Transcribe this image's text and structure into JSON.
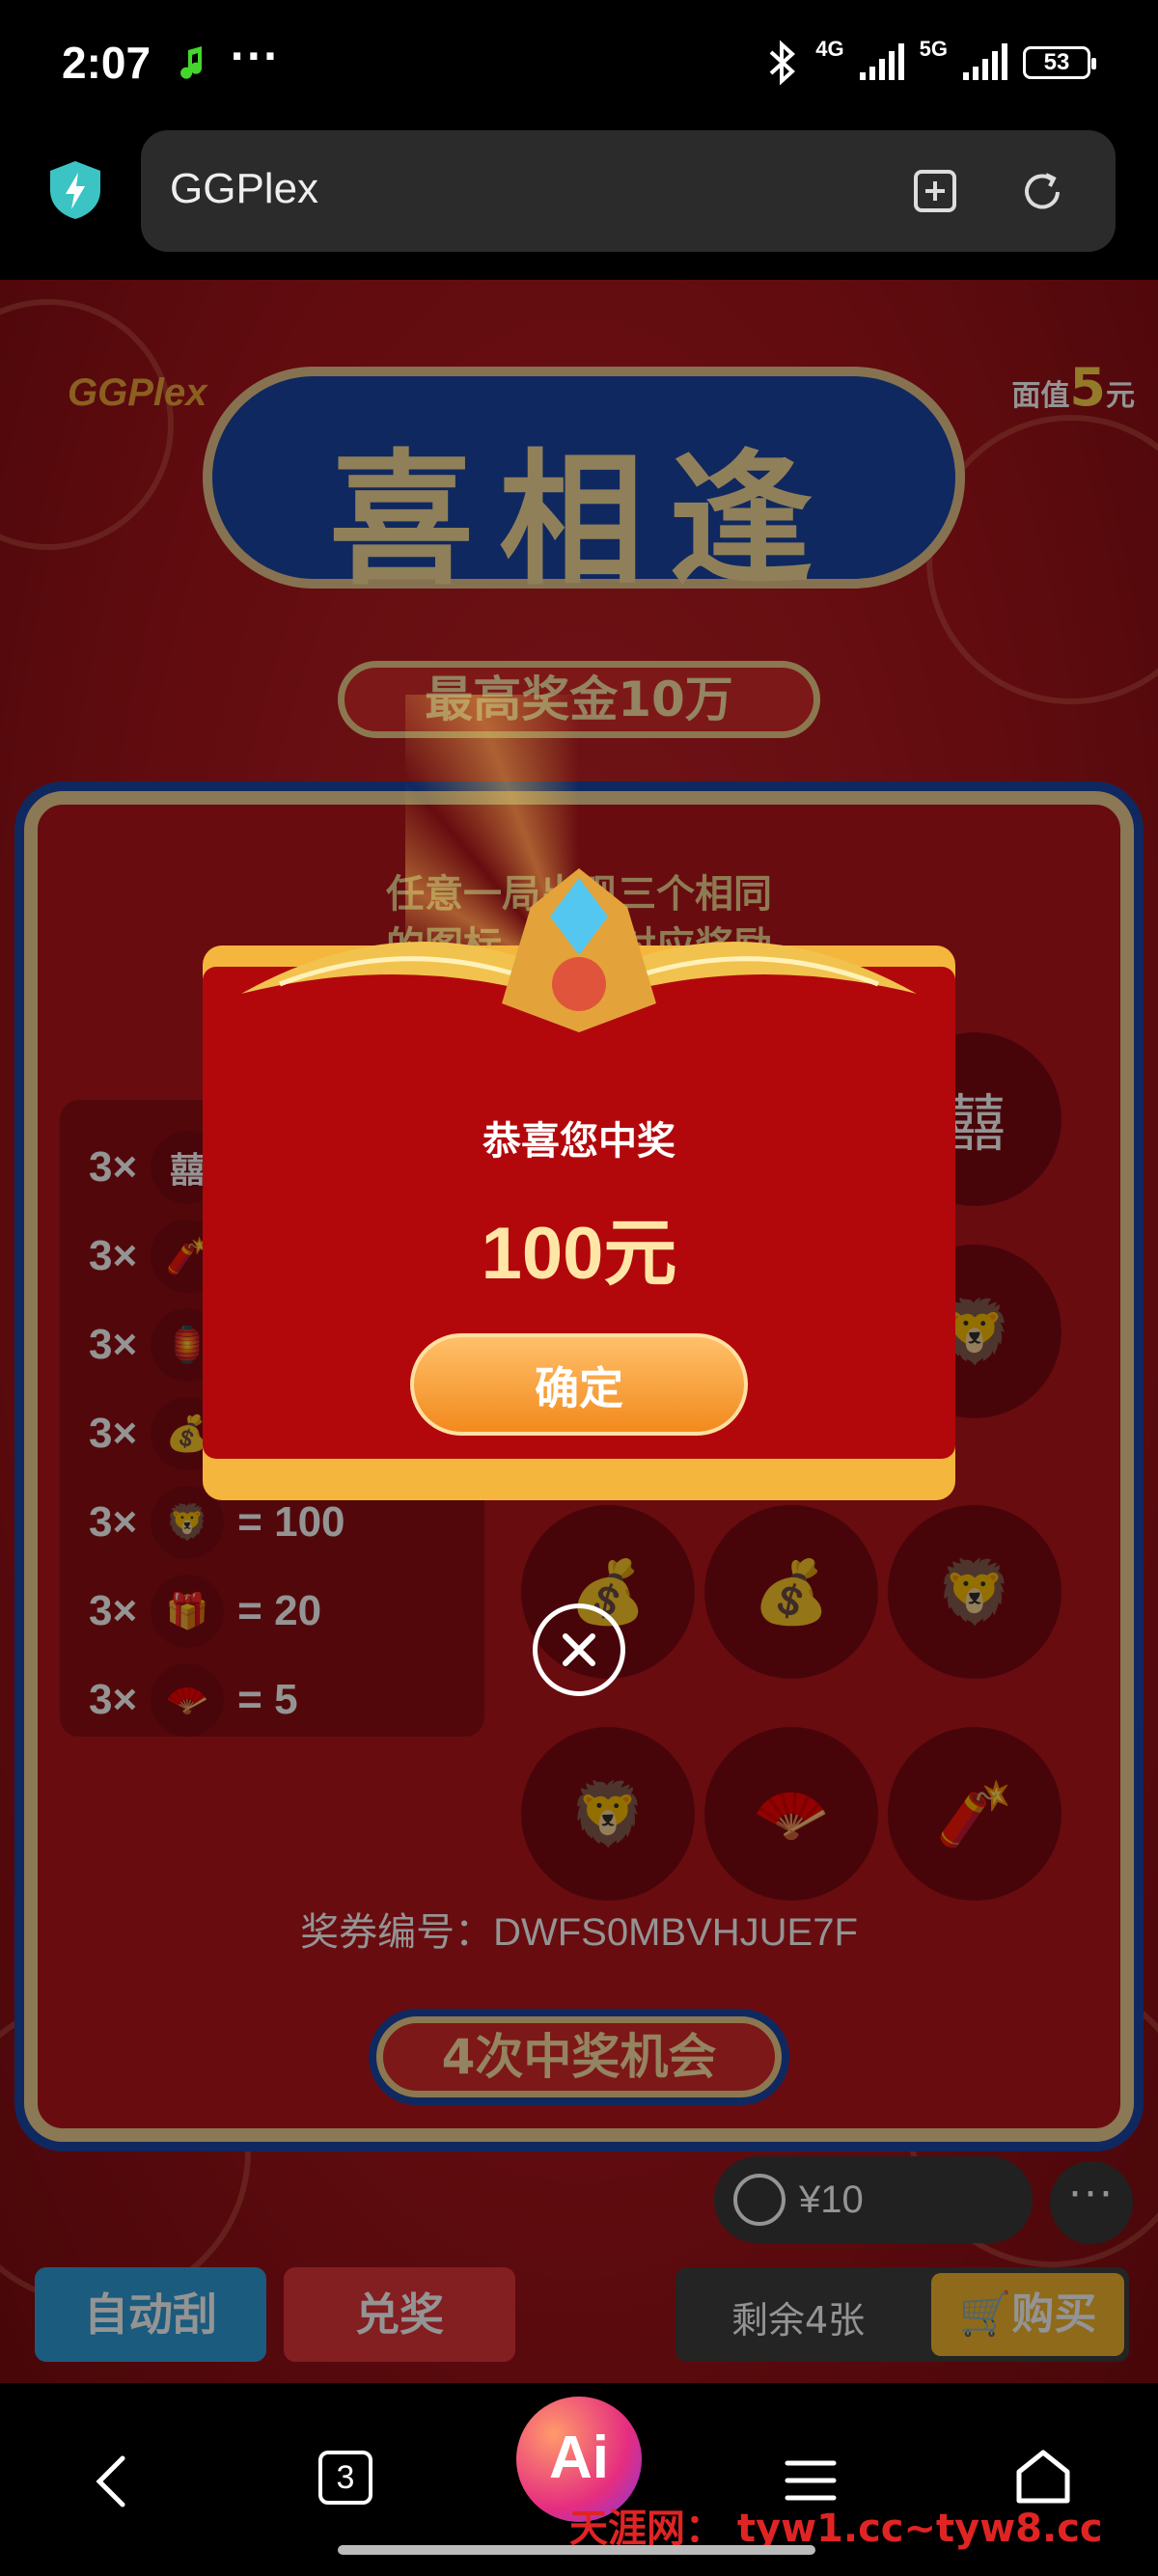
{
  "status": {
    "time": "2:07",
    "dots": "···",
    "net1": "4G",
    "net2": "5G",
    "battery": "53"
  },
  "browser": {
    "url_text": "GGPlex",
    "icons": [
      "shield-icon",
      "add-bookmark-icon",
      "refresh-icon"
    ]
  },
  "game": {
    "brand": "GGPlex",
    "face_value_prefix": "面值",
    "face_value_num": "5",
    "face_value_unit": "元",
    "title": "喜相逢",
    "subtitle": "最高奖金10万",
    "rule_line1": "任意一局出现三个相同",
    "rule_line2": "的图标，获得对应奖励",
    "paytable": [
      {
        "mult": "3×",
        "icon": "xi-character-icon",
        "prize": ""
      },
      {
        "mult": "3×",
        "icon": "firecracker-icon",
        "prize": ""
      },
      {
        "mult": "3×",
        "icon": "lantern-icon",
        "prize": ""
      },
      {
        "mult": "3×",
        "icon": "lucky-bag-icon",
        "prize": ""
      },
      {
        "mult": "3×",
        "icon": "lion-head-icon",
        "prize": "= 100"
      },
      {
        "mult": "3×",
        "icon": "gift-box-icon",
        "prize": "= 20"
      },
      {
        "mult": "3×",
        "icon": "fan-icon",
        "prize": "= 5"
      }
    ],
    "ticket_label": "奖券编号：",
    "ticket_id": "DWFS0MBVHJUE7F",
    "chance_banner": "4次中奖机会",
    "balance": "¥10",
    "more": "···",
    "auto_scratch": "自动刮",
    "redeem": "兑奖",
    "remaining": "剩余4张",
    "buy": "购买"
  },
  "modal": {
    "title": "恭喜您中奖",
    "amount": "100元",
    "confirm": "确定"
  },
  "nav": {
    "tabs_count": "3",
    "ai_label": "Ai",
    "watermark": "天涯网： tyw1.cc~tyw8.cc"
  },
  "colors": {
    "game_red": "#b4161c",
    "royal_blue": "#1a46a6",
    "gold": "#f0cf93",
    "modal_red": "#b2080c",
    "modal_button": "#f28a1d",
    "buy_button": "#f6b730",
    "auto_button": "#2f9ed9"
  }
}
